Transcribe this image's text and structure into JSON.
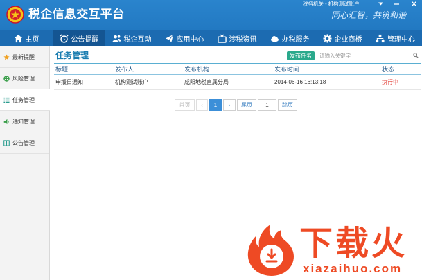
{
  "app": {
    "title": "税企信息交互平台",
    "account": "税务机关 - 机构测试账户",
    "slogan": "同心汇智，共筑和谐",
    "window_controls": [
      "menu-caret-icon",
      "minimize-icon",
      "close-icon"
    ],
    "colors": {
      "header": "#2279c2",
      "nav": "#1c6bb1",
      "nav_active": "#145592",
      "title": "#1a7db0",
      "button": "#2aa98c",
      "status_running": "#e1362e",
      "page_active": "#3c8fd8",
      "watermark": "#ee4a24"
    }
  },
  "nav": {
    "tabs": [
      {
        "label": "主页",
        "icon": "home-icon",
        "active": false
      },
      {
        "label": "公告提醒",
        "icon": "alarm-clock-icon",
        "active": true
      },
      {
        "label": "税企互动",
        "icon": "users-icon",
        "active": false
      },
      {
        "label": "应用中心",
        "icon": "paper-plane-icon",
        "active": false
      },
      {
        "label": "涉税资讯",
        "icon": "tv-icon",
        "active": false
      },
      {
        "label": "办税服务",
        "icon": "cloud-icon",
        "active": false
      },
      {
        "label": "企业商桥",
        "icon": "gear-icon",
        "active": false
      },
      {
        "label": "管理中心",
        "icon": "sitemap-icon",
        "active": false
      }
    ]
  },
  "sidebar": {
    "items": [
      {
        "label": "最新提醒",
        "icon": "star-icon",
        "active": false
      },
      {
        "label": "风险管理",
        "icon": "lifebuoy-icon",
        "active": false
      },
      {
        "label": "任务管理",
        "icon": "list-icon",
        "active": true
      },
      {
        "label": "通知管理",
        "icon": "speaker-icon",
        "active": false
      },
      {
        "label": "公告管理",
        "icon": "panel-icon",
        "active": false
      }
    ]
  },
  "main": {
    "title": "任务管理",
    "publish_button": "发布任务",
    "search_placeholder": "请输入关键字",
    "table": {
      "columns": [
        "标题",
        "发布人",
        "发布机构",
        "发布时间",
        "状态"
      ],
      "rows": [
        [
          "申报日通知",
          "机构测试账户",
          "咸阳地税直属分局",
          "2014-06-16 16:13:18",
          "执行中"
        ]
      ]
    },
    "pagination": {
      "first": "首页",
      "prev": "‹",
      "current": "1",
      "next": "›",
      "last": "尾页",
      "page_input": "1",
      "jump": "跳页"
    }
  },
  "watermark": {
    "brand": "下载火",
    "domain": "xiazaihuo.com"
  }
}
